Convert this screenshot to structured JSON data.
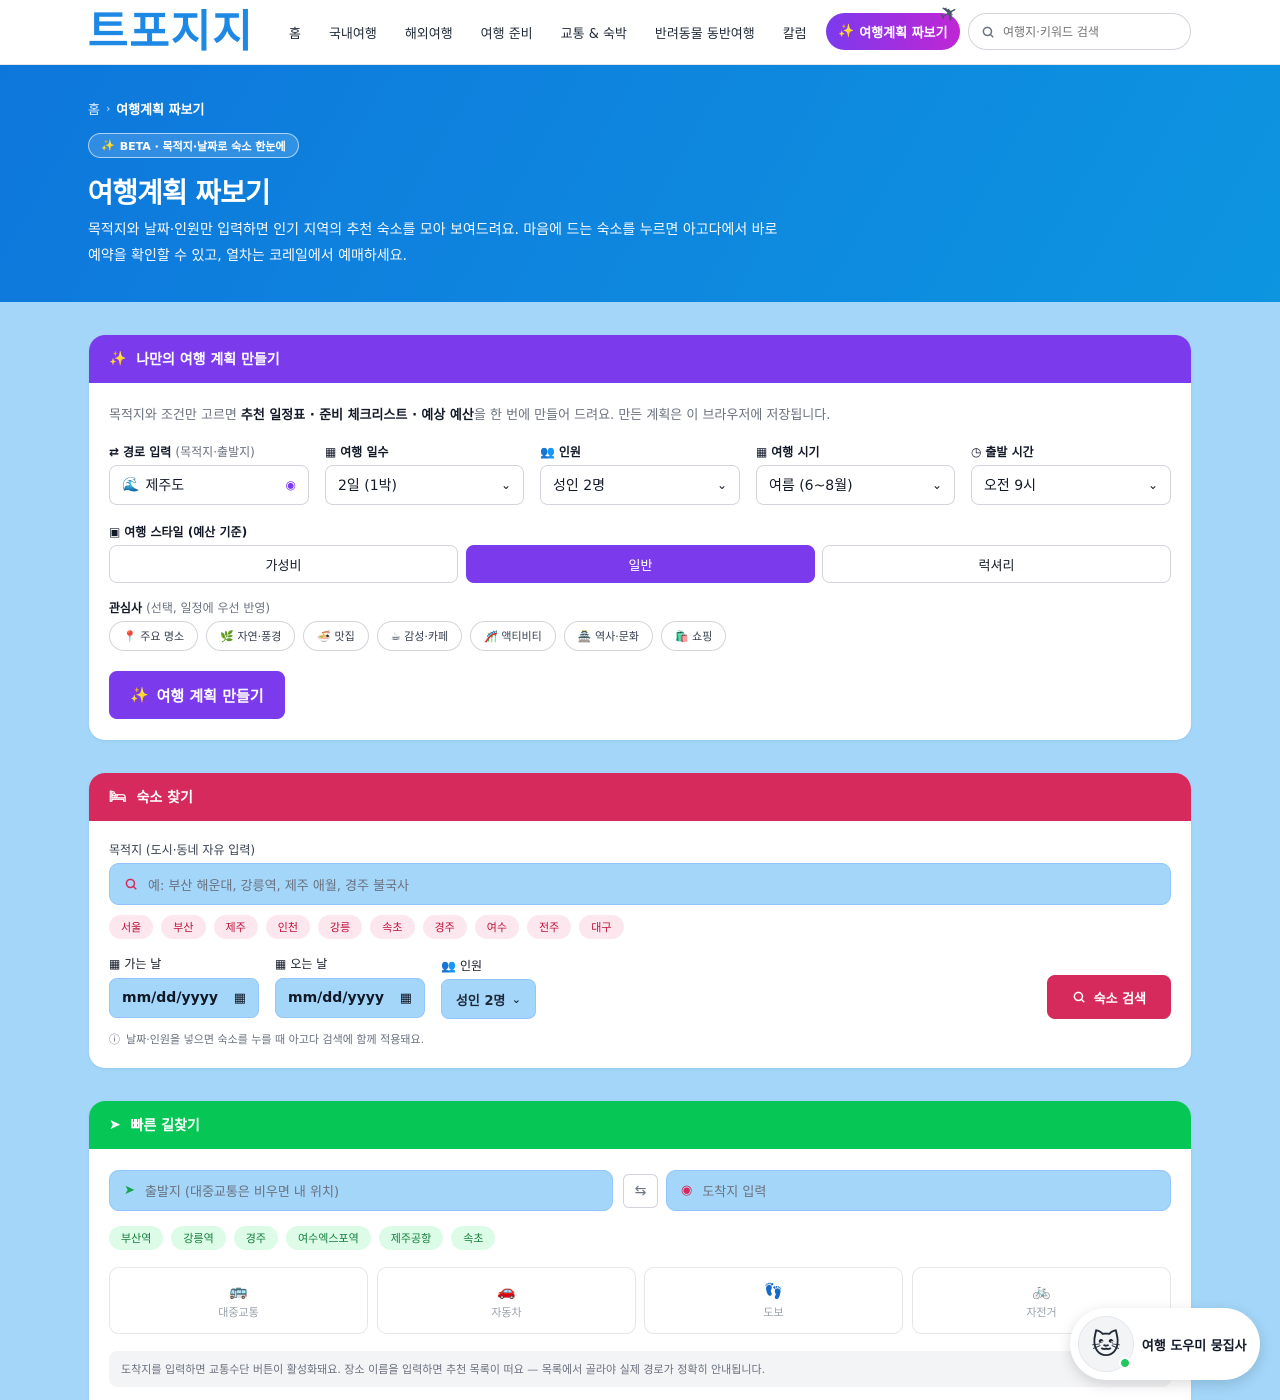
{
  "nav": {
    "logo": "트포지지",
    "items": [
      "홈",
      "국내여행",
      "해외여행",
      "여행 준비",
      "교통 & 숙박",
      "반려동물 동반여행",
      "칼럼"
    ],
    "plan_button": "여행계획 짜보기",
    "search_placeholder": "여행지·키워드 검색"
  },
  "hero": {
    "breadcrumb_home": "홈",
    "breadcrumb_current": "여행계획 짜보기",
    "beta": "BETA · 목적지·날짜로 숙소 한눈에",
    "title": "여행계획 짜보기",
    "desc": "목적지와 날짜·인원만 입력하면 인기 지역의 추천 숙소를 모아 보여드려요. 마음에 드는 숙소를 누르면 아고다에서 바로 예약을 확인할 수 있고, 열차는 코레일에서 예매하세요."
  },
  "planner": {
    "header": "나만의 여행 계획 만들기",
    "lead_pre": "목적지와 조건만 고르면 ",
    "lead_bold": "추천 일정표 · 준비 체크리스트 · 예상 예산",
    "lead_post": "을 한 번에 만들어 드려요. 만든 계획은 이 브라우저에 저장됩니다.",
    "route_label": "경로 입력",
    "route_sub": "(목적지·출발지)",
    "route_value": "제주도",
    "days_label": "여행 일수",
    "days_value": "2일 (1박)",
    "people_label": "인원",
    "people_value": "성인 2명",
    "season_label": "여행 시기",
    "season_value": "여름 (6~8월)",
    "depart_label": "출발 시간",
    "depart_value": "오전 9시",
    "style_label": "여행 스타일 (예산 기준)",
    "styles": [
      "가성비",
      "일반",
      "럭셔리"
    ],
    "interest_label": "관심사",
    "interest_sub": "(선택, 일정에 우선 반영)",
    "interests": [
      "📍 주요 명소",
      "🌿 자연·풍경",
      "🍜 맛집",
      "☕ 감성·카페",
      "🎢 액티비티",
      "🏯 역사·문화",
      "🛍️ 쇼핑"
    ],
    "make_button": "여행 계획 만들기"
  },
  "lodging": {
    "header": "숙소 찾기",
    "dest_label": "목적지 (도시·동네 자유 입력)",
    "dest_placeholder": "예: 부산 해운대, 강릉역, 제주 애월, 경주 불국사",
    "cities": [
      "서울",
      "부산",
      "제주",
      "인천",
      "강릉",
      "속초",
      "경주",
      "여수",
      "전주",
      "대구"
    ],
    "checkin_label": "가는 날",
    "checkout_label": "오는 날",
    "date_placeholder": "mm/dd/yyyy",
    "people_label": "인원",
    "people_value": "성인 2명",
    "search_button": "숙소 검색",
    "note": "날짜·인원을 넣으면 숙소를 누를 때 아고다 검색에 함께 적용돼요."
  },
  "route": {
    "header": "빠른 길찾기",
    "from_placeholder": "출발지 (대중교통은 비우면 내 위치)",
    "to_placeholder": "도착지 입력",
    "places": [
      "부산역",
      "강릉역",
      "경주",
      "여수엑스포역",
      "제주공항",
      "속초"
    ],
    "modes": [
      "대중교통",
      "자동차",
      "도보",
      "자전거"
    ],
    "info": "도착지를 입력하면 교통수단 버튼이 활성화돼요. 장소 이름을 입력하면 추천 목록이 떠요 — 목록에서 골라야 실제 경로가 정확히 안내됩니다."
  },
  "helper": {
    "label": "여행 도우미 뭉집사"
  },
  "colors": {
    "primary_blue": "#1e88e5",
    "planner_purple": "#7c3aed",
    "lodging_pink": "#d62a5c",
    "route_green": "#06c755",
    "page_bg": "#a3d6f9"
  }
}
